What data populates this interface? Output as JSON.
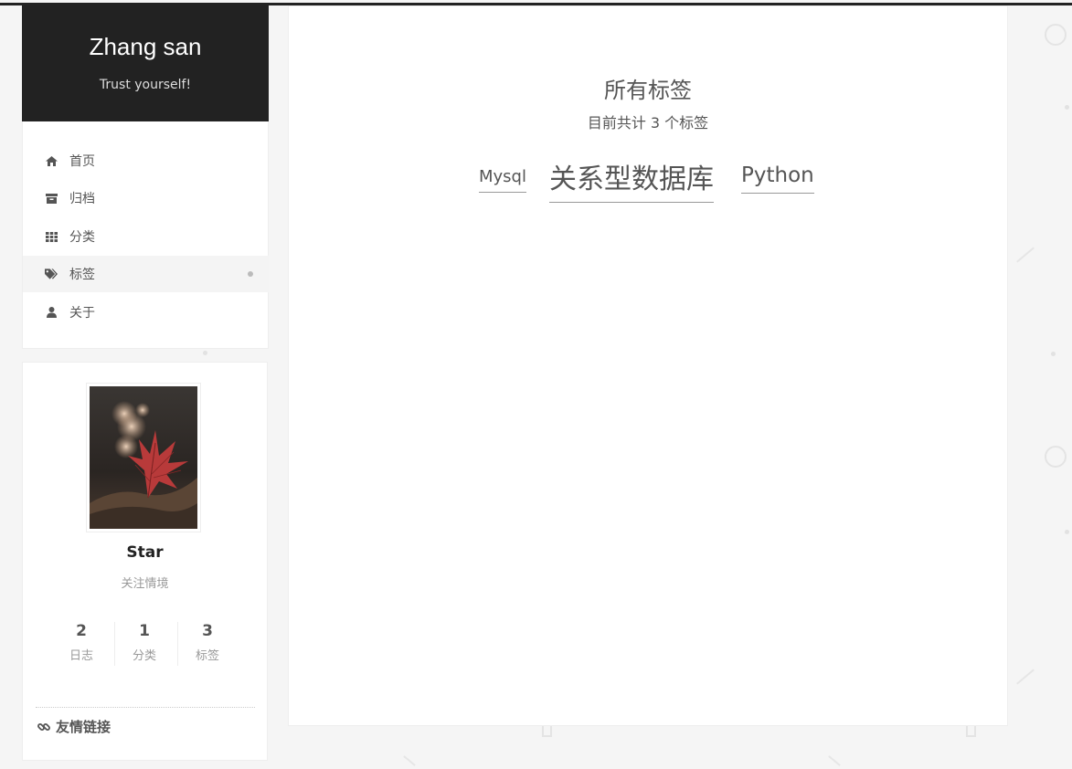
{
  "site": {
    "title": "Zhang san",
    "subtitle": "Trust yourself!"
  },
  "menu": [
    {
      "label": "首页",
      "icon": "home-icon",
      "active": false
    },
    {
      "label": "归档",
      "icon": "archive-icon",
      "active": false
    },
    {
      "label": "分类",
      "icon": "grid-icon",
      "active": false
    },
    {
      "label": "标签",
      "icon": "tags-icon",
      "active": true
    },
    {
      "label": "关于",
      "icon": "user-icon",
      "active": false
    }
  ],
  "author": {
    "name": "Star",
    "description": "关注情境",
    "avatar": "maple-leaf-photo",
    "stats": [
      {
        "count": "2",
        "label": "日志"
      },
      {
        "count": "1",
        "label": "分类"
      },
      {
        "count": "3",
        "label": "标签"
      }
    ],
    "links_title": "友情链接"
  },
  "main": {
    "title": "所有标签",
    "count_text": "目前共计 3 个标签",
    "tags": [
      {
        "label": "Mysql"
      },
      {
        "label": "关系型数据库"
      },
      {
        "label": "Python"
      }
    ]
  },
  "colors": {
    "header_bg": "#222222",
    "active_dot": "#bbbbbb",
    "text": "#555555"
  }
}
